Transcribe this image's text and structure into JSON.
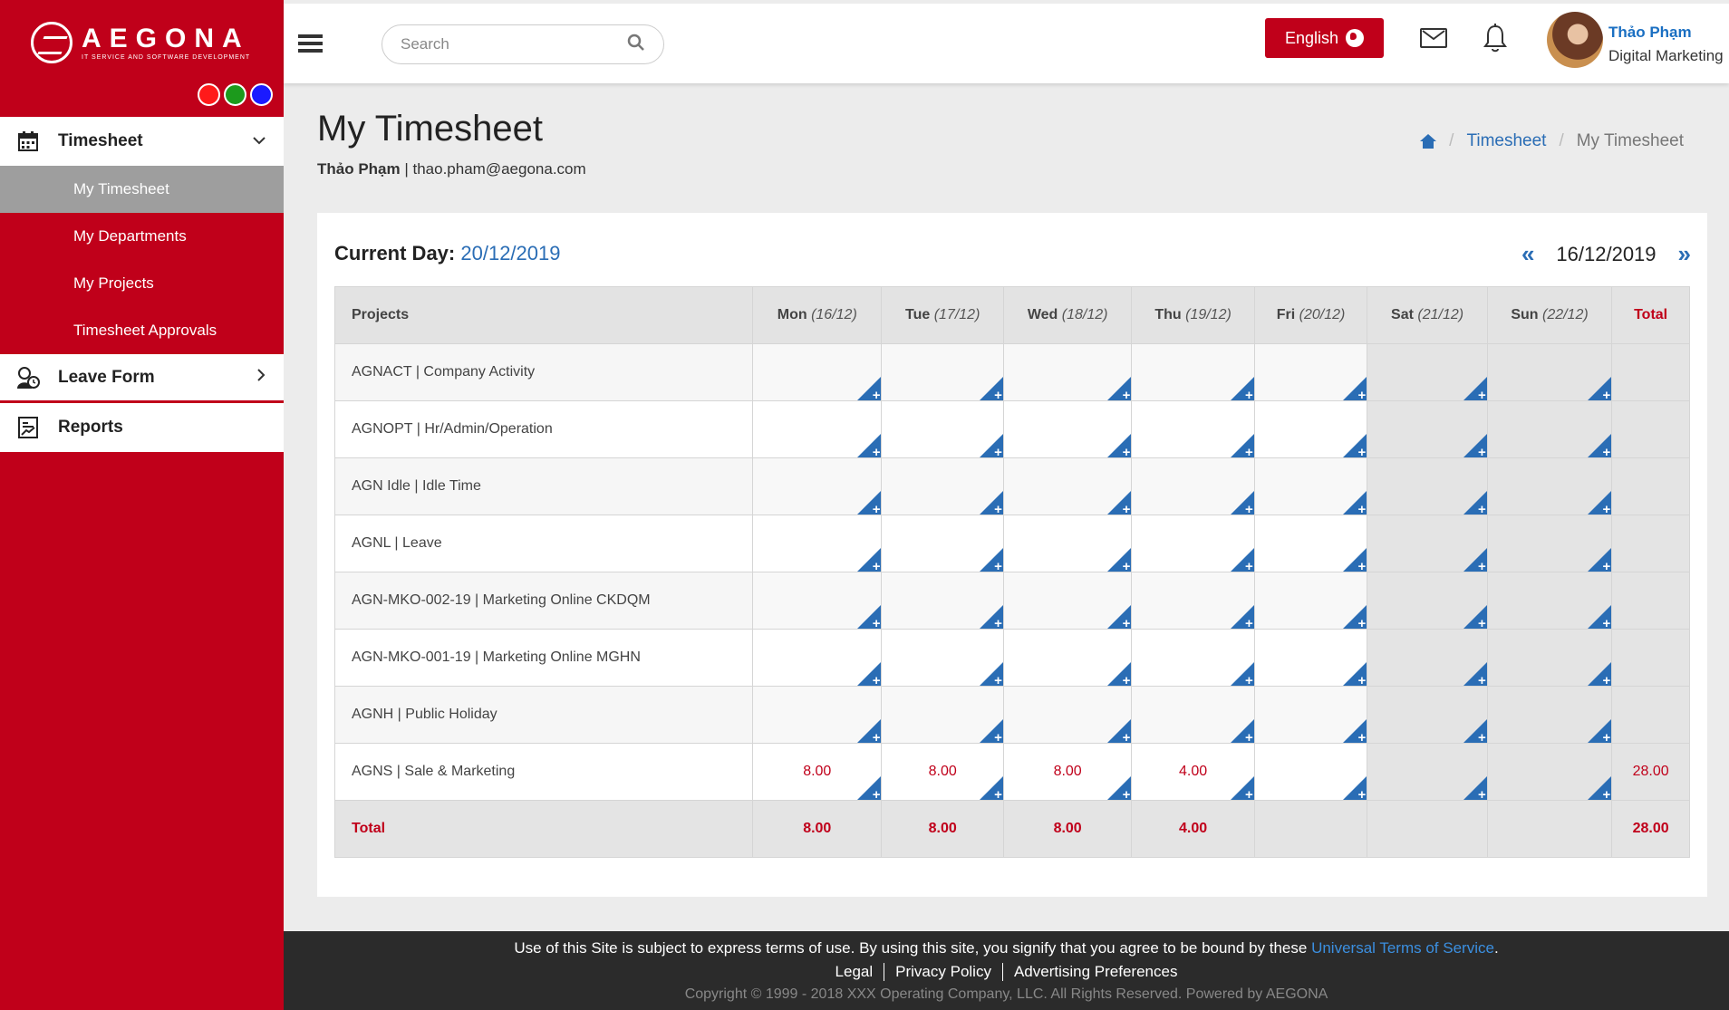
{
  "brand": {
    "name": "AEGONA",
    "tagline": "IT SERVICE AND SOFTWARE DEVELOPMENT",
    "swatches": [
      "#ff1a1a",
      "#1c9a1c",
      "#1a1aff"
    ]
  },
  "sidebar": {
    "timesheet_label": "Timesheet",
    "timesheet_items": [
      "My Timesheet",
      "My Departments",
      "My Projects",
      "Timesheet Approvals"
    ],
    "leave_label": "Leave Form",
    "reports_label": "Reports"
  },
  "topbar": {
    "search_placeholder": "Search",
    "language": "English",
    "user_name": "Thảo Phạm",
    "user_role": "Digital Marketing"
  },
  "page": {
    "title": "My Timesheet",
    "user_name": "Thảo Phạm",
    "user_email": "thao.pham@aegona.com",
    "breadcrumb": [
      "Timesheet",
      "My Timesheet"
    ]
  },
  "timesheet": {
    "current_day_label": "Current Day:",
    "current_day": "20/12/2019",
    "week_start": "16/12/2019",
    "prev_icon": "double-chevron-left-icon",
    "next_icon": "double-chevron-right-icon",
    "header": {
      "projects": "Projects",
      "days": [
        {
          "name": "Mon",
          "date": "(16/12)"
        },
        {
          "name": "Tue",
          "date": "(17/12)"
        },
        {
          "name": "Wed",
          "date": "(18/12)"
        },
        {
          "name": "Thu",
          "date": "(19/12)"
        },
        {
          "name": "Fri",
          "date": "(20/12)"
        },
        {
          "name": "Sat",
          "date": "(21/12)"
        },
        {
          "name": "Sun",
          "date": "(22/12)"
        }
      ],
      "total": "Total"
    },
    "rows": [
      {
        "project": "AGNACT | Company Activity",
        "hours": [
          "",
          "",
          "",
          "",
          "",
          "",
          ""
        ],
        "total": ""
      },
      {
        "project": "AGNOPT | Hr/Admin/Operation",
        "hours": [
          "",
          "",
          "",
          "",
          "",
          "",
          ""
        ],
        "total": ""
      },
      {
        "project": "AGN Idle | Idle Time",
        "hours": [
          "",
          "",
          "",
          "",
          "",
          "",
          ""
        ],
        "total": ""
      },
      {
        "project": "AGNL | Leave",
        "hours": [
          "",
          "",
          "",
          "",
          "",
          "",
          ""
        ],
        "total": ""
      },
      {
        "project": "AGN-MKO-002-19 | Marketing Online CKDQM",
        "hours": [
          "",
          "",
          "",
          "",
          "",
          "",
          ""
        ],
        "total": ""
      },
      {
        "project": "AGN-MKO-001-19 | Marketing Online MGHN",
        "hours": [
          "",
          "",
          "",
          "",
          "",
          "",
          ""
        ],
        "total": ""
      },
      {
        "project": "AGNH | Public Holiday",
        "hours": [
          "",
          "",
          "",
          "",
          "",
          "",
          ""
        ],
        "total": ""
      },
      {
        "project": "AGNS | Sale & Marketing",
        "hours": [
          "8.00",
          "8.00",
          "8.00",
          "4.00",
          "",
          "",
          ""
        ],
        "total": "28.00"
      }
    ],
    "footer": {
      "label": "Total",
      "totals": [
        "8.00",
        "8.00",
        "8.00",
        "4.00",
        "",
        "",
        ""
      ],
      "grand_total": "28.00"
    }
  },
  "footer": {
    "terms_text": "Use of this Site is subject to express terms of use. By using this site, you signify that you agree to be bound by these",
    "terms_link": "Universal Terms of Service",
    "links": [
      "Legal",
      "Privacy Policy",
      "Advertising Preferences"
    ],
    "copyright": "Copyright © 1999 - 2018 XXX Operating Company, LLC. All Rights Reserved. Powered by AEGONA"
  }
}
